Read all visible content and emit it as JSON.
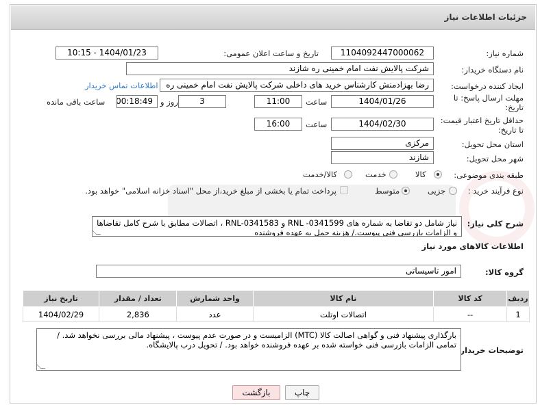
{
  "header": {
    "title": "جزئیات اطلاعات نیاز"
  },
  "fields": {
    "need_number_label": "شماره نیاز:",
    "need_number": "1104092447000062",
    "announce_label": "تاریخ و ساعت اعلان عمومی:",
    "announce_value": "1404/01/23 - 10:15",
    "buyer_org_label": "نام دستگاه خریدار:",
    "buyer_org": "شرکت پالایش نفت امام خمینی  ره  شازند",
    "creator_label": "ایجاد کننده درخواست:",
    "creator": "رضا بهزادمنش کارشناس خرید های داخلی  شرکت پالایش نفت امام خمینی  ره",
    "contact_link": "اطلاعات تماس خریدار",
    "deadline_label_1": "مهلت ارسال پاسخ: تا",
    "deadline_label_2": "تاریخ:",
    "deadline_date": "1404/01/26",
    "time_label": "ساعت",
    "deadline_time": "11:00",
    "days_value": "3",
    "days_label": "روز و",
    "remaining_time": "00:18:49",
    "remaining_label": "ساعت باقی مانده",
    "validity_label_1": "حداقل تاریخ اعتبار قیمت:",
    "validity_label_2": "تا تاریخ:",
    "validity_date": "1404/02/30",
    "validity_time": "16:00",
    "province_label": "استان محل تحویل:",
    "province": "مرکزی",
    "city_label": "شهر محل تحویل:",
    "city": "شازند",
    "category_label": "طبقه بندی موضوعی:",
    "category_options": [
      "کالا",
      "خدمت",
      "کالا/خدمت"
    ],
    "process_label": "نوع فرآیند خرید :",
    "process_options": [
      "جزیی",
      "متوسط"
    ],
    "payment_note": "پرداخت تمام یا بخشی از مبلغ خرید،از محل \"اسناد خزانه اسلامی\" خواهد بود."
  },
  "description": {
    "label": "شرح کلی نیاز:",
    "text": "نیاز شامل دو تقاضا به شماره های RNL -0341599 و RNL-0341583 ، اتصالات مطابق با شرح کامل تقاضاها و الزامات بازرسی فنی پیوست./ هزینه حمل به عهده فروشنده"
  },
  "goods": {
    "section_title": "اطلاعات کالاهای مورد نیاز",
    "group_label": "گروه کالا:",
    "group_value": "امور تاسیساتی",
    "columns": [
      "ردیف",
      "کد کالا",
      "نام کالا",
      "واحد شمارش",
      "تعداد / مقدار",
      "تاریخ نیاز"
    ],
    "rows": [
      {
        "row": "1",
        "code": "--",
        "name": "اتصالات اوتلت",
        "unit": "عدد",
        "qty": "2,836",
        "date": "1404/02/29"
      }
    ]
  },
  "buyer_notes": {
    "label": "توضیحات خریدار:",
    "text": "بارگذاری پیشنهاد فنی و گواهی اصالت کالا (MTC) الزامیست و در صورت عدم پیوست ، پیشنهاد مالی بررسی نخواهد شد. / تمامی الزامات بازرسی فنی خواسته شده بر عهده فروشنده خواهد بود. / تحویل درب پالایشگاه."
  },
  "buttons": {
    "print": "چاپ",
    "back": "بازگشت"
  },
  "colors": {
    "link": "#2f7bc7",
    "header_bg": "#d9d9d9",
    "back_button_bg": "#fbe3e3"
  }
}
